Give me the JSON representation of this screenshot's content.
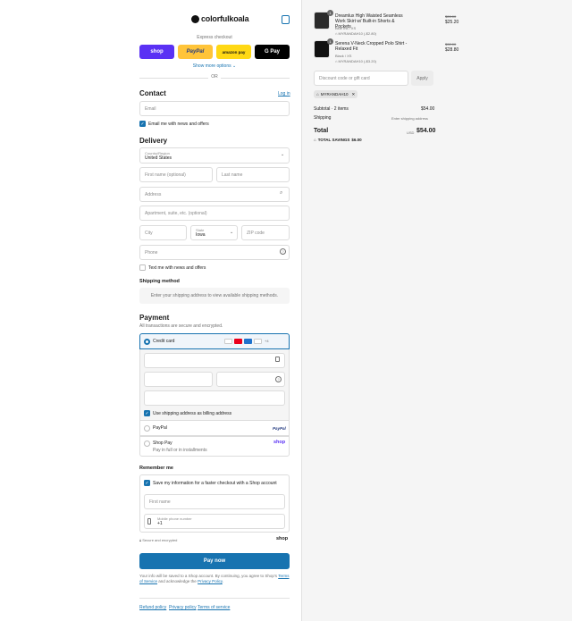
{
  "brand": {
    "name": "colorfulkoala",
    "cart_icon": "bag-icon"
  },
  "express": {
    "title": "Express checkout",
    "shop_label": "shop",
    "paypal_label": "PayPal",
    "amazon_label": "amazon pay",
    "gpay_label": "G Pay",
    "more_label": "Show more options ⌄",
    "or_label": "OR"
  },
  "contact": {
    "heading": "Contact",
    "login_label": "Log in",
    "email_placeholder": "Email",
    "news_label": "Email me with news and offers"
  },
  "delivery": {
    "heading": "Delivery",
    "country_label": "Country/Region",
    "country_value": "United States",
    "first_placeholder": "First name (optional)",
    "last_placeholder": "Last name",
    "address_placeholder": "Address",
    "apt_placeholder": "Apartment, suite, etc. (optional)",
    "city_placeholder": "City",
    "state_label": "State",
    "state_value": "Iowa",
    "zip_placeholder": "ZIP code",
    "phone_placeholder": "Phone",
    "text_label": "Text me with news and offers"
  },
  "shipping": {
    "heading": "Shipping method",
    "message": "Enter your shipping address to view available shipping methods."
  },
  "payment": {
    "heading": "Payment",
    "subtitle": "All transactions are secure and encrypted.",
    "credit_label": "Credit card",
    "card_more": "+4",
    "billing_label": "Use shipping address as billing address",
    "paypal_label": "PayPal",
    "paypal_logo": "PayPal",
    "shoppay_label": "Shop Pay",
    "shoppay_sub": "Pay in full or in installments",
    "shop_logo": "shop"
  },
  "remember": {
    "heading": "Remember me",
    "save_label": "Save my information for a faster checkout with a Shop account",
    "name_placeholder": "First name",
    "phone_label": "Mobile phone number",
    "phone_value": "+1",
    "secure_label": "Secure and encrypted",
    "shop_logo": "shop"
  },
  "pay_now": "Pay now",
  "legal": {
    "text": "Your info will be saved to a Shop account. By continuing, you agree to Shop's",
    "terms": "Terms of Service",
    "and": "and acknowledge the",
    "privacy": "Privacy Policy",
    "dot": "."
  },
  "footer": {
    "refund": "Refund policy",
    "privacy": "Privacy policy",
    "terms": "Terms of service"
  },
  "cart": {
    "items": [
      {
        "qty": "1",
        "title": "Dreamlux High Waisted Seamless Work Skirt w/ Built-in Shorts & Pockets",
        "variant": "Blue Ink / XS",
        "discount": "MYRANDAH10 (-$2.80)",
        "old": "$28.00",
        "price": "$25.20"
      },
      {
        "qty": "1",
        "title": "Serena V-Neck Cropped Polo Shirt - Relaxed Fit",
        "variant": "Black / XS",
        "discount": "MYRANDAH10 (-$3.20)",
        "old": "$32.00",
        "price": "$28.80"
      }
    ],
    "code_placeholder": "Discount code or gift card",
    "apply": "Apply",
    "applied_code": "MYRANDAH10",
    "subtotal_label": "Subtotal · 2 items",
    "subtotal": "$54.00",
    "shipping_label": "Shipping",
    "shipping_value": "Enter shipping address",
    "total_label": "Total",
    "currency": "USD",
    "total": "$54.00",
    "savings_label": "TOTAL SAVINGS",
    "savings": "$6.00"
  }
}
